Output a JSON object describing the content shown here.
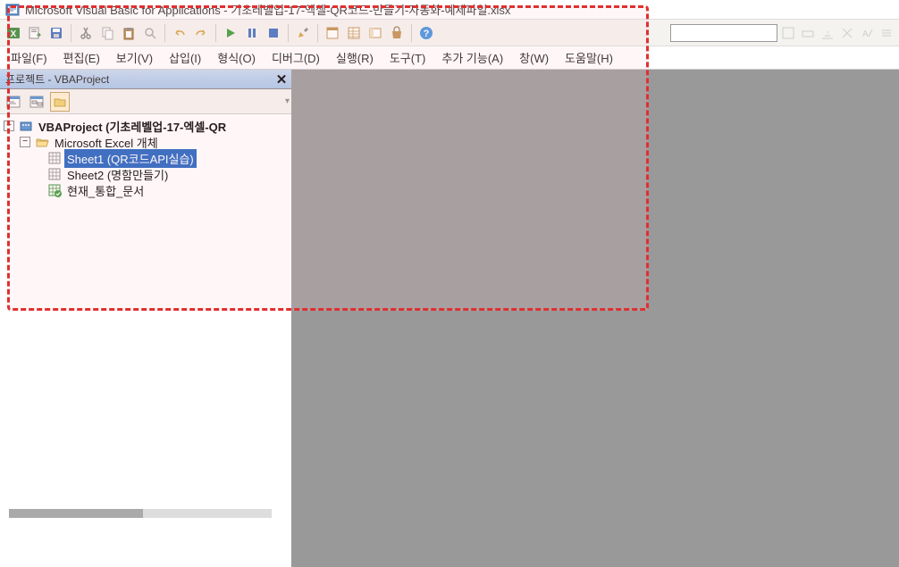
{
  "title": "Microsoft Visual Basic for Applications - 기초레벨업-17-엑셀-QR코드-만들기-자동화-예제파일.xlsx",
  "menu": {
    "file": "파일(F)",
    "edit": "편집(E)",
    "view": "보기(V)",
    "insert": "삽입(I)",
    "format": "형식(O)",
    "debug": "디버그(D)",
    "run": "실행(R)",
    "tools": "도구(T)",
    "addins": "추가 기능(A)",
    "window": "창(W)",
    "help": "도움말(H)"
  },
  "panel": {
    "title": "프로젝트 - VBAProject"
  },
  "tree": {
    "project": "VBAProject (기초레벨업-17-엑셀-QR",
    "folder": "Microsoft Excel 개체",
    "sheet1": "Sheet1 (QR코드API실습)",
    "sheet2": "Sheet2 (명함만들기)",
    "workbook": "현재_통합_문서"
  }
}
